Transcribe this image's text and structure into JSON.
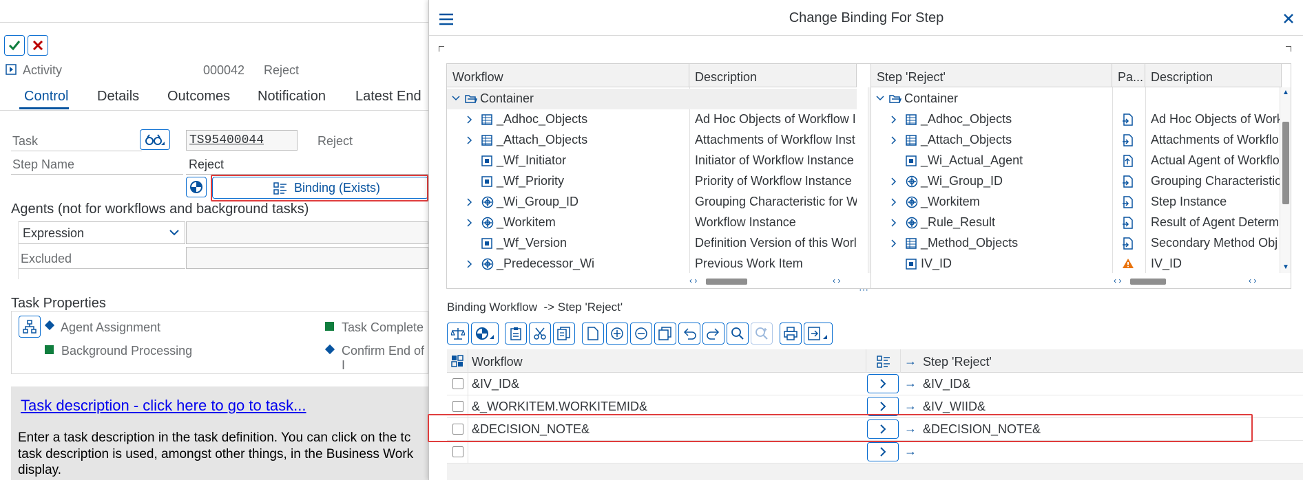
{
  "left": {
    "activity_label": "Activity",
    "activity_number": "000042",
    "activity_name": "Reject",
    "tabs": [
      "Control",
      "Details",
      "Outcomes",
      "Notification",
      "Latest End"
    ],
    "task_label": "Task",
    "task_value": "TS95400044",
    "task_desc": "Reject",
    "step_name_label": "Step Name",
    "step_name_value": "Reject",
    "binding_button": "Binding (Exists)",
    "agents_heading": "Agents (not for workflows and background tasks)",
    "expression_value": "Expression",
    "excluded_label": "Excluded",
    "task_props_heading": "Task Properties",
    "props": {
      "agent_assignment": "Agent Assignment",
      "task_complete": "Task Complete",
      "background_processing": "Background Processing",
      "confirm_end": "Confirm End of I"
    },
    "task_desc_link": "Task description - click here to go to task...",
    "task_desc_text_1": "Enter a task description in the task definition. You can click on the tc",
    "task_desc_text_2": "task description is used, amongst other things, in the Business Work",
    "task_desc_text_3": "display."
  },
  "dialog": {
    "title": "Change Binding For Step",
    "left_tree": {
      "col_workflow": "Workflow",
      "col_description": "Description",
      "rows": [
        {
          "name": "Container",
          "desc": ""
        },
        {
          "name": "_Adhoc_Objects",
          "desc": "Ad Hoc Objects of Workflow I"
        },
        {
          "name": "_Attach_Objects",
          "desc": "Attachments of Workflow Inst"
        },
        {
          "name": "_Wf_Initiator",
          "desc": "Initiator of Workflow Instance"
        },
        {
          "name": "_Wf_Priority",
          "desc": "Priority of Workflow Instance"
        },
        {
          "name": "_Wi_Group_ID",
          "desc": "Grouping Characteristic for W"
        },
        {
          "name": "_Workitem",
          "desc": "Workflow Instance"
        },
        {
          "name": "_Wf_Version",
          "desc": "Definition Version of this Worl"
        },
        {
          "name": "_Predecessor_Wi",
          "desc": "Previous Work Item"
        }
      ]
    },
    "right_tree": {
      "col_step": "Step 'Reject'",
      "col_pa": "Pa...",
      "col_description": "Description",
      "rows": [
        {
          "name": "Container",
          "desc": ""
        },
        {
          "name": "_Adhoc_Objects",
          "desc": "Ad Hoc Objects of Work"
        },
        {
          "name": "_Attach_Objects",
          "desc": "Attachments of Workflo"
        },
        {
          "name": "_Wi_Actual_Agent",
          "desc": "Actual Agent of Workflo"
        },
        {
          "name": "_Wi_Group_ID",
          "desc": "Grouping Characteristic"
        },
        {
          "name": "_Workitem",
          "desc": "Step Instance"
        },
        {
          "name": "_Rule_Result",
          "desc": "Result of Agent Determ"
        },
        {
          "name": "_Method_Objects",
          "desc": "Secondary Method Obj"
        },
        {
          "name": "IV_ID",
          "desc": "IV_ID"
        }
      ]
    },
    "binding_label": "Binding Workflow  -> Step 'Reject'",
    "grid": {
      "col_workflow": "Workflow",
      "col_step": "Step 'Reject'",
      "rows": [
        {
          "workflow": "&IV_ID&",
          "step": "&IV_ID&"
        },
        {
          "workflow": "&_WORKITEM.WORKITEMID&",
          "step": "&IV_WIID&"
        },
        {
          "workflow": "&DECISION_NOTE&",
          "step": "&DECISION_NOTE&"
        },
        {
          "workflow": "",
          "step": ""
        }
      ]
    }
  },
  "colors": {
    "accent": "#0854a0",
    "highlight": "#e03d3d",
    "ok_green": "#107e3e",
    "cancel_red": "#bb0000",
    "warning": "#e9730c"
  }
}
